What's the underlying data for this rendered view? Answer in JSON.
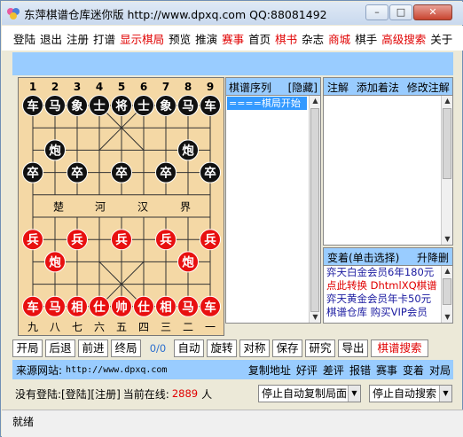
{
  "window": {
    "title": "东萍棋谱仓库迷你版 http://www.dpxq.com QQ:88081492",
    "minimize_glyph": "–",
    "maximize_glyph": "□",
    "close_glyph": "✕"
  },
  "menu": [
    {
      "label": "登陆",
      "color": "#000000"
    },
    {
      "label": "退出",
      "color": "#000000"
    },
    {
      "label": "注册",
      "color": "#000000"
    },
    {
      "label": "打谱",
      "color": "#000000"
    },
    {
      "label": "显示棋局",
      "color": "#e00000"
    },
    {
      "label": "预览",
      "color": "#000000"
    },
    {
      "label": "推演",
      "color": "#000000"
    },
    {
      "label": "赛事",
      "color": "#e00000"
    },
    {
      "label": "首页",
      "color": "#000000"
    },
    {
      "label": "棋书",
      "color": "#e00000"
    },
    {
      "label": "杂志",
      "color": "#000000"
    },
    {
      "label": "商城",
      "color": "#e00000"
    },
    {
      "label": "棋手",
      "color": "#000000"
    },
    {
      "label": "高级搜索",
      "color": "#e00000"
    },
    {
      "label": "关于",
      "color": "#000000"
    }
  ],
  "board": {
    "top_numbers": [
      "1",
      "2",
      "3",
      "4",
      "5",
      "6",
      "7",
      "8",
      "9"
    ],
    "bottom_numbers": [
      "九",
      "八",
      "七",
      "六",
      "五",
      "四",
      "三",
      "二",
      "一"
    ],
    "river": [
      "楚",
      "河",
      "汉",
      "界"
    ],
    "black_color": "#111111",
    "red_color": "#e81010",
    "pieces": [
      {
        "c": 0,
        "r": 0,
        "t": "车",
        "side": "black"
      },
      {
        "c": 1,
        "r": 0,
        "t": "马",
        "side": "black"
      },
      {
        "c": 2,
        "r": 0,
        "t": "象",
        "side": "black"
      },
      {
        "c": 3,
        "r": 0,
        "t": "士",
        "side": "black"
      },
      {
        "c": 4,
        "r": 0,
        "t": "将",
        "side": "black"
      },
      {
        "c": 5,
        "r": 0,
        "t": "士",
        "side": "black"
      },
      {
        "c": 6,
        "r": 0,
        "t": "象",
        "side": "black"
      },
      {
        "c": 7,
        "r": 0,
        "t": "马",
        "side": "black"
      },
      {
        "c": 8,
        "r": 0,
        "t": "车",
        "side": "black"
      },
      {
        "c": 1,
        "r": 2,
        "t": "炮",
        "side": "black"
      },
      {
        "c": 7,
        "r": 2,
        "t": "炮",
        "side": "black"
      },
      {
        "c": 0,
        "r": 3,
        "t": "卒",
        "side": "black"
      },
      {
        "c": 2,
        "r": 3,
        "t": "卒",
        "side": "black"
      },
      {
        "c": 4,
        "r": 3,
        "t": "卒",
        "side": "black"
      },
      {
        "c": 6,
        "r": 3,
        "t": "卒",
        "side": "black"
      },
      {
        "c": 8,
        "r": 3,
        "t": "卒",
        "side": "black"
      },
      {
        "c": 0,
        "r": 6,
        "t": "兵",
        "side": "red"
      },
      {
        "c": 2,
        "r": 6,
        "t": "兵",
        "side": "red"
      },
      {
        "c": 4,
        "r": 6,
        "t": "兵",
        "side": "red"
      },
      {
        "c": 6,
        "r": 6,
        "t": "兵",
        "side": "red"
      },
      {
        "c": 8,
        "r": 6,
        "t": "兵",
        "side": "red"
      },
      {
        "c": 1,
        "r": 7,
        "t": "炮",
        "side": "red"
      },
      {
        "c": 7,
        "r": 7,
        "t": "炮",
        "side": "red"
      },
      {
        "c": 0,
        "r": 9,
        "t": "车",
        "side": "red"
      },
      {
        "c": 1,
        "r": 9,
        "t": "马",
        "side": "red"
      },
      {
        "c": 2,
        "r": 9,
        "t": "相",
        "side": "red"
      },
      {
        "c": 3,
        "r": 9,
        "t": "仕",
        "side": "red"
      },
      {
        "c": 4,
        "r": 9,
        "t": "帅",
        "side": "red"
      },
      {
        "c": 5,
        "r": 9,
        "t": "仕",
        "side": "red"
      },
      {
        "c": 6,
        "r": 9,
        "t": "相",
        "side": "red"
      },
      {
        "c": 7,
        "r": 9,
        "t": "马",
        "side": "red"
      },
      {
        "c": 8,
        "r": 9,
        "t": "车",
        "side": "red"
      }
    ]
  },
  "sequence": {
    "title": "棋谱序列",
    "hide": "[隐藏]",
    "selected": "====棋局开始"
  },
  "notes": {
    "tabs": [
      "注解",
      "添加着法",
      "修改注解"
    ]
  },
  "ads": {
    "title": "变着(单击选择)",
    "action": "升降删",
    "lines": [
      {
        "text": "弈天白金会员6年180元",
        "color": "#1a1aa0"
      },
      {
        "text": "点此转换 DhtmlXQ棋谱",
        "color": "#e00000"
      },
      {
        "text": "弈天黄金会员年卡50元",
        "color": "#1a1aa0"
      },
      {
        "text": "棋谱仓库 购买VIP会员",
        "color": "#1a1aa0"
      }
    ]
  },
  "controls": {
    "buttons": [
      "开局",
      "后退",
      "前进",
      "终局"
    ],
    "counter": "0/0",
    "buttons2": [
      "自动",
      "旋转",
      "对称",
      "保存",
      "研究",
      "导出"
    ],
    "search": "棋谱搜索"
  },
  "source": {
    "label": "来源网站:",
    "url": "http://www.dpxq.com",
    "links": [
      "复制地址",
      "好评",
      "差评",
      "报错",
      "赛事",
      "变着",
      "对局"
    ]
  },
  "login": {
    "status_prefix": "没有登陆:",
    "login_link": "[登陆]",
    "register_link": "[注册]",
    "online_label": "当前在线:",
    "online_count": "2889",
    "online_unit": "人",
    "combo1": "停止自动复制局面",
    "combo2": "停止自动搜索"
  },
  "status": "就绪"
}
